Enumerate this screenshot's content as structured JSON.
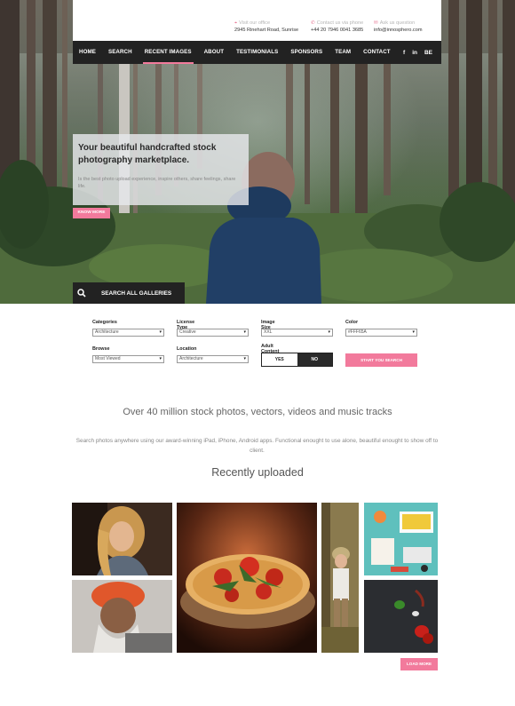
{
  "header": {
    "contacts": [
      {
        "icon": "location-pin-icon",
        "label": "Visit our office",
        "value": "2945 Rinehart Road, Sunrise"
      },
      {
        "icon": "phone-icon",
        "label": "Contact us via phone",
        "value": "+44 20 7946 0041 3685"
      },
      {
        "icon": "mail-icon",
        "label": "Ask us question",
        "value": "info@innosphero.com"
      }
    ]
  },
  "nav": {
    "items": [
      "HOME",
      "SEARCH",
      "RECENT IMAGES",
      "ABOUT",
      "TESTIMONIALS",
      "SPONSORS",
      "TEAM",
      "CONTACT"
    ],
    "active": "RECENT IMAGES",
    "social": [
      "f",
      "in",
      "BE"
    ]
  },
  "hero": {
    "title": "Your beautiful handcrafted stock photography marketplace.",
    "description": "Is the best photo upload experience, inspire others, share feelings, share life.",
    "cta": "KNOW MORE",
    "search_tab": "SEARCH ALL GALLERIES"
  },
  "filters": {
    "categories": {
      "label": "Categories",
      "value": "Architecture"
    },
    "license": {
      "label": "License Type",
      "value": "Creative"
    },
    "image_size": {
      "label": "Image Size",
      "value": "XXL"
    },
    "color": {
      "label": "Color",
      "value": "#FFF65A"
    },
    "browse": {
      "label": "Browse",
      "value": "Most Viewed"
    },
    "location": {
      "label": "Location",
      "value": "Architecture"
    },
    "adult": {
      "label": "Adult Content",
      "yes": "YES",
      "no": "NO"
    },
    "start_button": "START YOU SEARCH"
  },
  "content": {
    "headline": "Over 40 million stock photos, vectors, videos and music tracks",
    "subtext": "Search photos anywhere using our award-winning iPad, iPhone, Android apps. Functional enought to use alone, beautiful enought to show off to client.",
    "section_title": "Recently uploaded",
    "load_more": "LOAD MORE"
  },
  "gallery": [
    "blonde-woman-portrait",
    "pizza-closeup",
    "child-in-forest",
    "man-orange-turban",
    "workspace-flatlay",
    "peppers-on-dark"
  ],
  "colors": {
    "accent": "#f27a9c",
    "dark": "#222222"
  }
}
